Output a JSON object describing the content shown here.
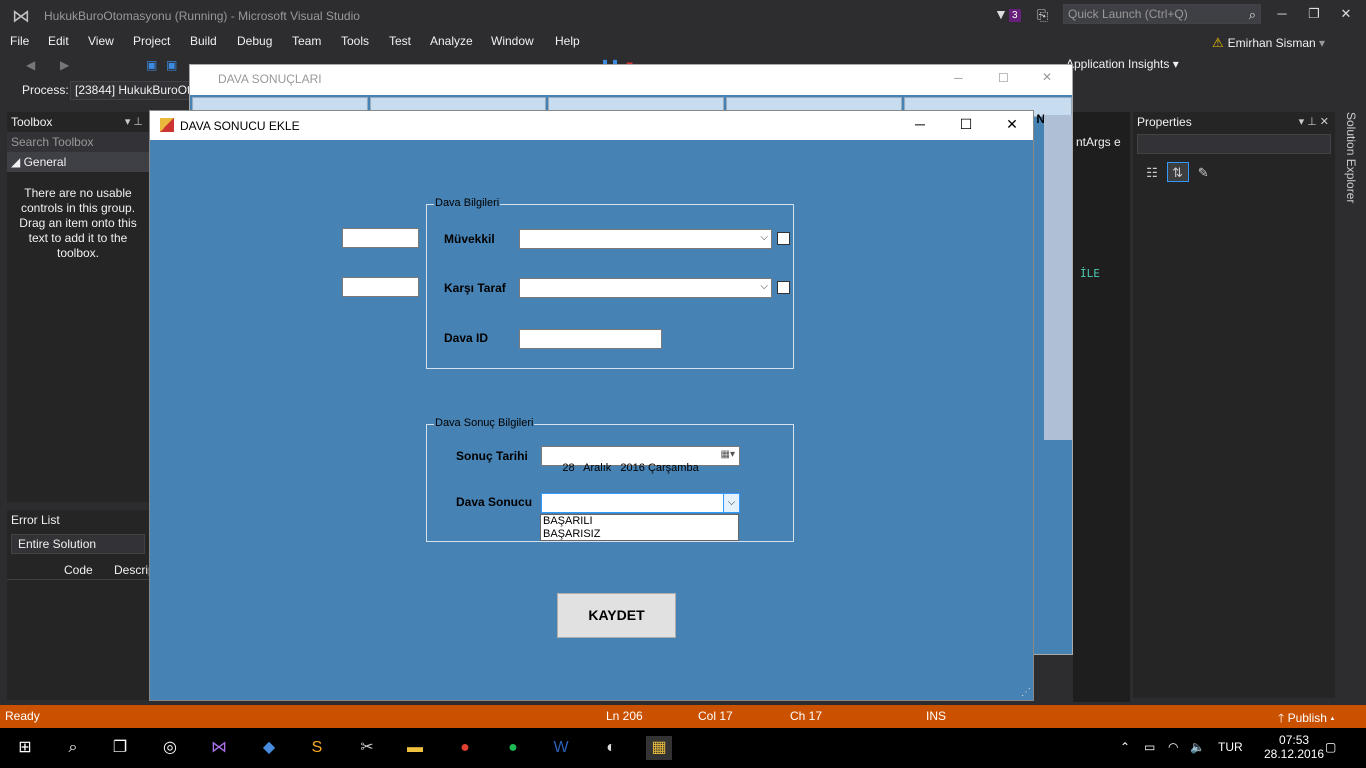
{
  "vs": {
    "window_title": "HukukBuroOtomasyonu (Running) - Microsoft Visual Studio",
    "notification_count": "3",
    "quick_launch_placeholder": "Quick Launch (Ctrl+Q)",
    "menu": [
      "File",
      "Edit",
      "View",
      "Project",
      "Build",
      "Debug",
      "Team",
      "Tools",
      "Test",
      "Analyze",
      "Window",
      "Help"
    ],
    "user_name": "Emirhan Sisman",
    "app_insights": "Application Insights",
    "process_label": "Process:",
    "process_value": "[23844] HukukBuroOt",
    "code_fragment": "ntArgs e",
    "code_keyword": "İLE"
  },
  "toolbox": {
    "title": "Toolbox",
    "search_placeholder": "Search Toolbox",
    "group": "General",
    "empty_message": "There are no usable controls in this group. Drag an item onto this text to add it to the toolbox."
  },
  "error_list": {
    "title": "Error List",
    "scope": "Entire Solution",
    "col_code": "Code",
    "col_desc": "Descrip"
  },
  "properties": {
    "title": "Properties"
  },
  "solution_explorer": {
    "label": "Solution Explorer"
  },
  "back_window": {
    "title": "DAVA SONUÇLARI",
    "tab_fragment": "N"
  },
  "dialog": {
    "title": "DAVA SONUCU EKLE",
    "group1_title": "Dava Bilgileri",
    "muvekkil_label": "Müvekkil",
    "karsi_taraf_label": "Karşı Taraf",
    "dava_id_label": "Dava ID",
    "group2_title": "Dava Sonuç Bilgileri",
    "sonuc_tarihi_label": "Sonuç Tarihi",
    "sonuc_tarihi_value": "28   Aralık   2016 Çarşamba",
    "dava_sonucu_label": "Dava Sonucu",
    "dava_sonucu_options": [
      "BAŞARILI",
      "BAŞARISIZ"
    ],
    "save_label": "KAYDET"
  },
  "statusbar": {
    "state": "Ready",
    "ln": "Ln 206",
    "col": "Col 17",
    "ch": "Ch 17",
    "ins": "INS",
    "publish": "Publish"
  },
  "taskbar": {
    "language": "TUR",
    "time": "07:53",
    "date": "28.12.2016"
  },
  "colors": {
    "vs_bg": "#2d2d30",
    "form_bg": "#4682b4",
    "statusbar": "#ca5100"
  }
}
